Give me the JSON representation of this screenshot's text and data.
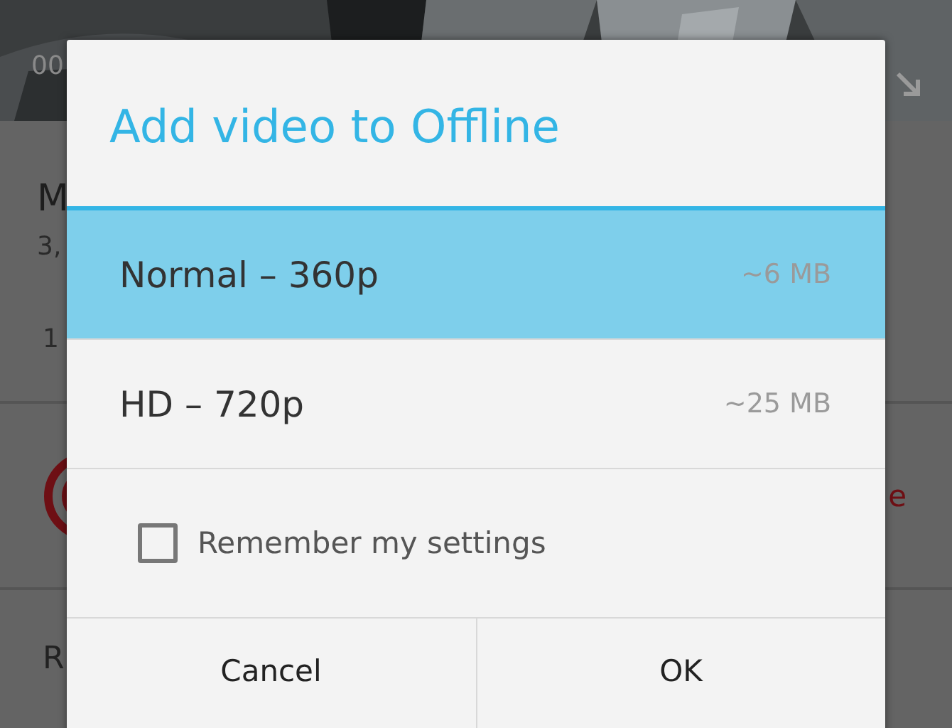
{
  "video": {
    "time": "00"
  },
  "page": {
    "title": "M",
    "views": "3,",
    "meta": "1",
    "channel_action": "e",
    "next_heading": "R"
  },
  "dialog": {
    "title": "Add video to Offline",
    "options": [
      {
        "label": "Normal – 360p",
        "size": "~6 MB",
        "selected": true
      },
      {
        "label": "HD – 720p",
        "size": "~25 MB",
        "selected": false
      }
    ],
    "remember": {
      "label": "Remember my settings",
      "checked": false
    },
    "buttons": [
      "Cancel",
      "OK"
    ]
  }
}
